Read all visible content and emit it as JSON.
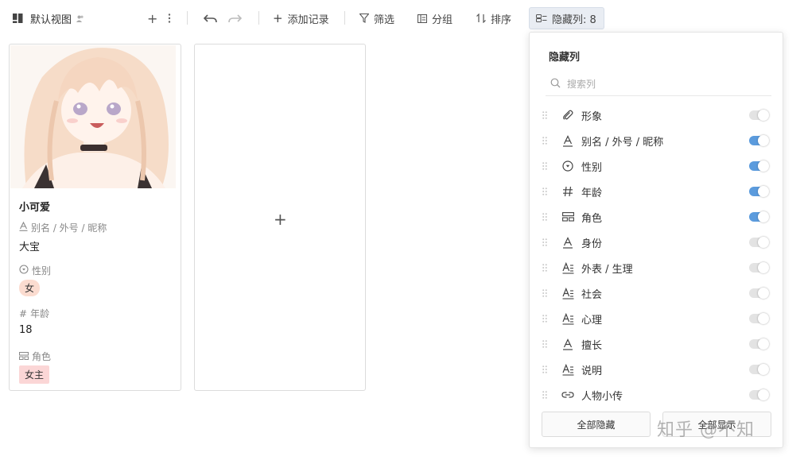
{
  "toolbar": {
    "view_title": "默认视图",
    "add_record": "添加记录",
    "filter": "筛选",
    "group": "分组",
    "sort": "排序",
    "hidden_columns": "隐藏列: 8"
  },
  "card": {
    "title": "小可爱",
    "fields": [
      {
        "label": "别名 / 外号 / 昵称",
        "value": "大宝"
      },
      {
        "label": "性别",
        "value": "女"
      },
      {
        "label": "年龄",
        "value": "18"
      },
      {
        "label": "角色",
        "value": "女主"
      }
    ]
  },
  "add_card": {
    "plus": "+"
  },
  "panel": {
    "title": "隐藏列",
    "search_placeholder": "搜索列",
    "columns": [
      {
        "name": "形象",
        "icon": "attachment-icon",
        "visible": false
      },
      {
        "name": "别名 / 外号 / 昵称",
        "icon": "text-icon",
        "visible": true
      },
      {
        "name": "性别",
        "icon": "single-select-icon",
        "visible": true
      },
      {
        "name": "年龄",
        "icon": "number-icon",
        "visible": true
      },
      {
        "name": "角色",
        "icon": "multi-select-icon",
        "visible": true
      },
      {
        "name": "身份",
        "icon": "text-icon",
        "visible": false
      },
      {
        "name": "外表 / 生理",
        "icon": "long-text-icon",
        "visible": false
      },
      {
        "name": "社会",
        "icon": "long-text-icon",
        "visible": false
      },
      {
        "name": "心理",
        "icon": "long-text-icon",
        "visible": false
      },
      {
        "name": "擅长",
        "icon": "text-icon",
        "visible": false
      },
      {
        "name": "说明",
        "icon": "long-text-icon",
        "visible": false
      },
      {
        "name": "人物小传",
        "icon": "link-icon",
        "visible": false
      }
    ],
    "hide_all": "全部隐藏",
    "show_all": "全部显示"
  },
  "watermark": "知乎 @不知",
  "colors": {
    "toggle_on": "#5b9bdd",
    "toggle_off": "#e3e3e3",
    "gender_tag": "#fbdcd0",
    "role_tag": "#fbd6d6"
  }
}
